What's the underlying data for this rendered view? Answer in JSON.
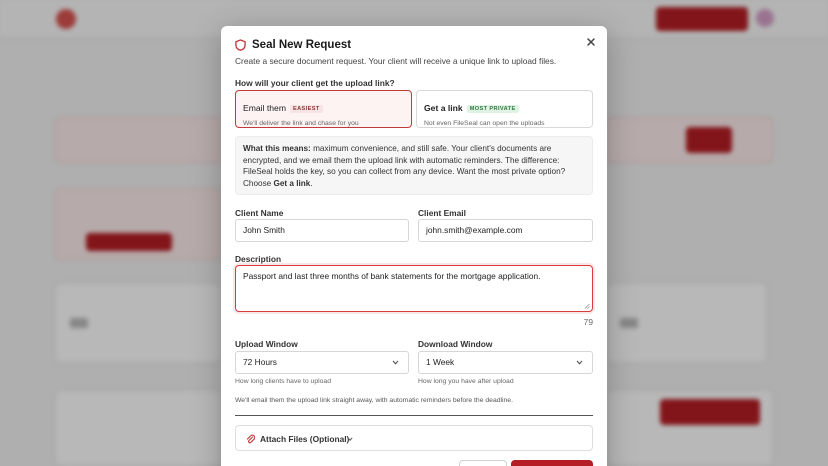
{
  "modal": {
    "title": "Seal New Request",
    "description": "Create a secure document request. Your client will receive a unique link to upload files.",
    "question": "How will your client get the upload link?",
    "options": [
      {
        "name": "Email them",
        "badge": "EASIEST",
        "sub": "We'll deliver the link and chase for you",
        "selected": true
      },
      {
        "name": "Get a link",
        "badge": "MOST PRIVATE",
        "sub": "Not even FileSeal can open the uploads",
        "selected": false
      }
    ],
    "info": {
      "lead": "What this means:",
      "body": " maximum convenience, and still safe. Your client's documents are encrypted, and we email them the upload link with automatic reminders. The difference: FileSeal holds the key, so you can collect from any device. Want the most private option? Choose ",
      "emphasis": "Get a link",
      "tail": "."
    },
    "client_name": {
      "label": "Client Name",
      "value": "John Smith"
    },
    "client_email": {
      "label": "Client Email",
      "value": "john.smith@example.com"
    },
    "description_field": {
      "label": "Description",
      "value": "Passport and last three months of bank statements for the mortgage application.",
      "char_count": "79"
    },
    "upload_window": {
      "label": "Upload Window",
      "value": "72 Hours",
      "hint": "How long clients have to upload"
    },
    "download_window": {
      "label": "Download Window",
      "value": "1 Week",
      "hint": "How long you have after upload"
    },
    "note": "We'll email them the upload link straight away, with automatic reminders before the deadline.",
    "attach_label": "Attach Files (Optional)"
  },
  "colors": {
    "accent": "#b51e24",
    "selected_border": "#c23a3a",
    "private_badge": "#2f7a3e"
  },
  "icons": {
    "title": "shield-icon",
    "close": "close-icon",
    "attach": "paperclip-icon",
    "dropdown": "chevron-down-icon"
  }
}
